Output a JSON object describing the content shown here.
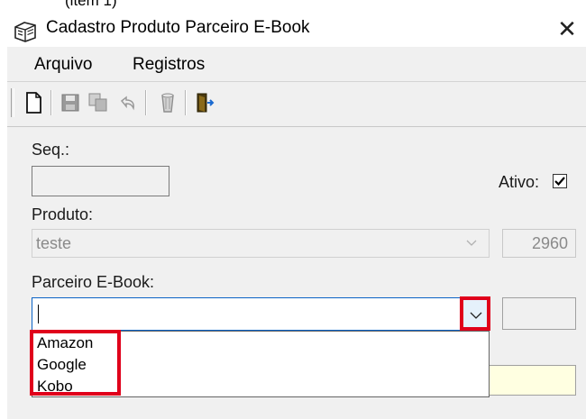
{
  "clipped_label": "(item 1)",
  "window": {
    "title": "Cadastro Produto Parceiro E-Book",
    "close_glyph": "✕"
  },
  "menu": {
    "items": [
      {
        "label": "Arquivo"
      },
      {
        "label": "Registros"
      }
    ]
  },
  "toolbar": {
    "buttons": [
      "new-icon",
      "save-icon",
      "copy-icon",
      "undo-icon",
      "delete-icon",
      "exit-icon"
    ]
  },
  "form": {
    "seq_label": "Seq.:",
    "seq_value": "",
    "ativo_label": "Ativo:",
    "ativo_checked": true,
    "produto_label": "Produto:",
    "produto_value": "teste",
    "produto_code": "2960",
    "parceiro_label": "Parceiro E-Book:",
    "parceiro_value": "",
    "parceiro_options": [
      "Amazon",
      "Google",
      "Kobo"
    ]
  },
  "colors": {
    "highlight": "#e0001b",
    "focus_border": "#0a62c5",
    "window_bg": "#f0f0f0"
  }
}
